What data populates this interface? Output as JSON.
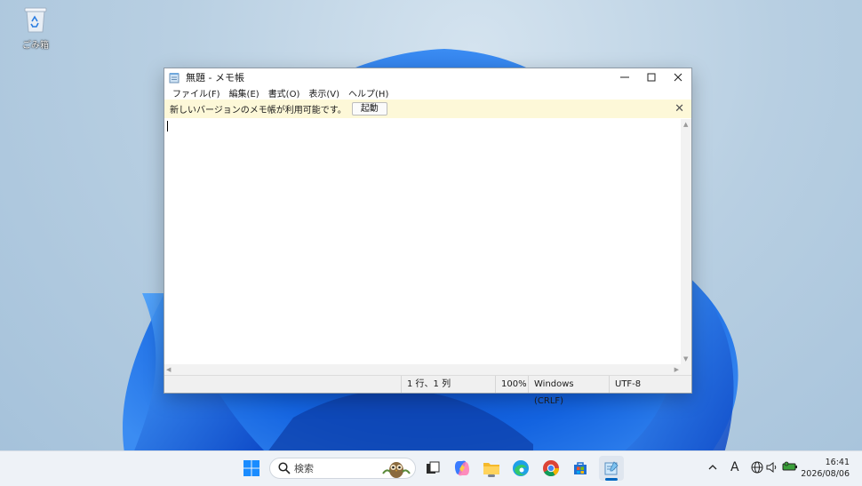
{
  "desktop": {
    "recycle_bin_label": "ごみ箱"
  },
  "window": {
    "title": "無題 - メモ帳",
    "menu": [
      "ファイル(F)",
      "編集(E)",
      "書式(O)",
      "表示(V)",
      "ヘルプ(H)"
    ],
    "infobar": {
      "message": "新しいバージョンのメモ帳が利用可能です。",
      "button": "起動"
    },
    "content": "",
    "status": {
      "position": "1 行、1 列",
      "zoom": "100%",
      "line_ending": "Windows (CRLF)",
      "encoding": "UTF-8"
    }
  },
  "taskbar": {
    "search_placeholder": "検索",
    "apps": [
      "start-icon",
      "search-icon",
      "task-view-icon",
      "copilot-icon",
      "file-explorer-icon",
      "edge-icon",
      "chrome-icon",
      "store-icon",
      "notepad-icon"
    ],
    "ime_indicator": "A",
    "time": "16:41",
    "date": "2026/08/06"
  },
  "colors": {
    "accent": "#0067c0",
    "infobar_bg": "#fdf8d8",
    "taskbar_bg": "#eef2f7"
  }
}
